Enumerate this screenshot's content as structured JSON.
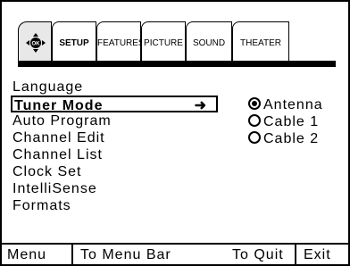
{
  "tabs": [
    {
      "label": "SETUP",
      "active": true
    },
    {
      "label": "FEATURES",
      "active": false
    },
    {
      "label": "PICTURE",
      "active": false
    },
    {
      "label": "SOUND",
      "active": false
    },
    {
      "label": "THEATER",
      "active": false
    }
  ],
  "ok_icon_label": "OK",
  "menu_items": [
    "Language",
    "Tuner Mode",
    "Auto Program",
    "Channel Edit",
    "Channel List",
    "Clock Set",
    "IntelliSense",
    "Formats"
  ],
  "selected_item": "Tuner Mode",
  "options": [
    {
      "label": "Antenna",
      "checked": true
    },
    {
      "label": "Cable 1",
      "checked": false
    },
    {
      "label": "Cable 2",
      "checked": false
    }
  ],
  "bottom": {
    "menu": "Menu",
    "to_menu_bar": "To Menu Bar",
    "to_quit": "To Quit",
    "exit": "Exit"
  }
}
